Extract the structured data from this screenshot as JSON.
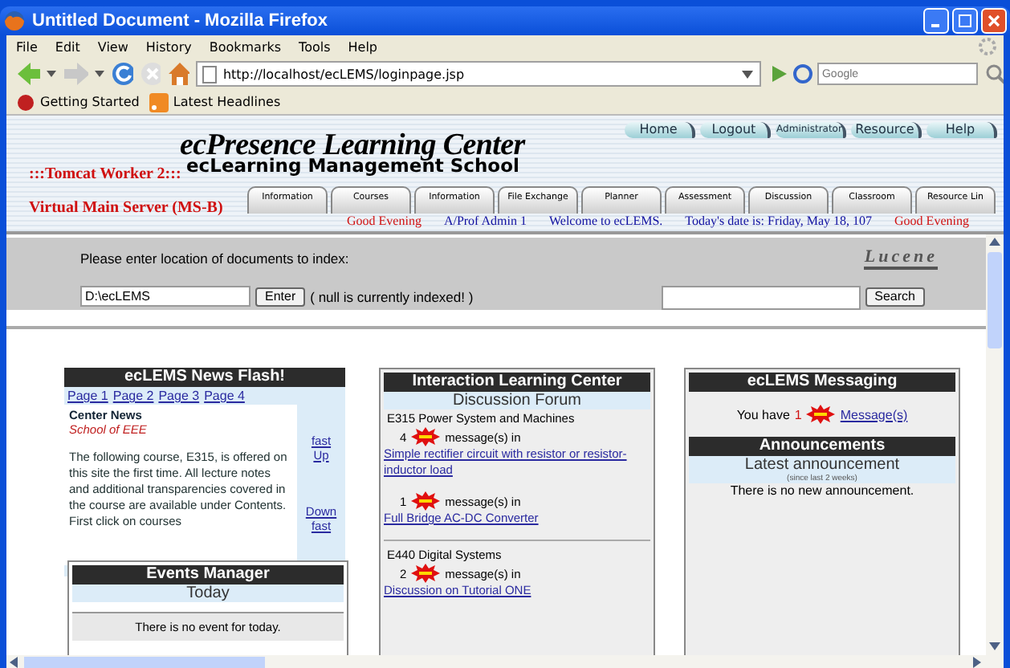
{
  "window": {
    "title": "Untitled Document - Mozilla Firefox"
  },
  "menu": [
    "File",
    "Edit",
    "View",
    "History",
    "Bookmarks",
    "Tools",
    "Help"
  ],
  "toolbar": {
    "url": "http://localhost/ecLEMS/loginpage.jsp",
    "search_placeholder": "Google"
  },
  "bookmarks": [
    "Getting Started",
    "Latest Headlines"
  ],
  "header": {
    "nav_buttons": [
      "Home",
      "Logout",
      "Administrator",
      "Resource",
      "Help"
    ],
    "title": "ecPresence Learning Center",
    "subtitle": "ecLearning Management School",
    "worker": ":::Tomcat Worker 2:::",
    "server": "Virtual Main Server (MS-B)",
    "tabs": [
      {
        "label": "Information",
        "selected": false
      },
      {
        "label": "Courses",
        "selected": false
      },
      {
        "label": "Information",
        "selected": false
      },
      {
        "label": "File Exchange",
        "selected": false
      },
      {
        "label": "Planner",
        "selected": false
      },
      {
        "label": "Assessment",
        "selected": false
      },
      {
        "label": "Discussion",
        "selected": false
      },
      {
        "label": "Classroom",
        "selected": false
      },
      {
        "label": "Resource Lin",
        "selected": false
      }
    ],
    "status_line": [
      {
        "text": "Good Evening",
        "kind": "greeting"
      },
      {
        "text": "A/Prof Admin 1",
        "kind": "info"
      },
      {
        "text": "Welcome to ecLEMS.",
        "kind": "info"
      },
      {
        "text": "Today's date is: Friday, May 18, 107",
        "kind": "info"
      },
      {
        "text": "Good Evening",
        "kind": "greeting"
      }
    ]
  },
  "index_panel": {
    "prompt": "Please enter location of documents to index:",
    "path": "D:\\ecLEMS",
    "enter_button": "Enter",
    "note": "( null is currently indexed! )",
    "logo": "Lucene",
    "search_button": "Search"
  },
  "news": {
    "title": "ecLEMS News Flash!",
    "pages": [
      "Page 1",
      "Page 2",
      "Page 3",
      "Page 4"
    ],
    "heading": "Center News",
    "source": "School of EEE",
    "body": "The following course, E315, is offered on this site the first time. All lecture notes and additional transparencies covered in the course are available under Contents. First click on courses",
    "scroll_up": "fast Up",
    "scroll_down": "Down fast"
  },
  "events": {
    "title": "Events Manager",
    "subtitle": "Today",
    "message": "There is no event for today."
  },
  "forum": {
    "title": "Interaction Learning Center",
    "subtitle": "Discussion Forum",
    "groups": [
      {
        "course": "E315 Power System and Machines",
        "posts": [
          {
            "count": "4",
            "label": "message(s) in",
            "topic": "Simple rectifier circuit with resistor or resistor-inductor load"
          },
          {
            "count": "1",
            "label": "message(s) in",
            "topic": "Full Bridge AC-DC Converter"
          }
        ]
      },
      {
        "course": "E440 Digital Systems",
        "posts": [
          {
            "count": "2",
            "label": "message(s) in",
            "topic": "Discussion on Tutorial ONE"
          }
        ]
      }
    ]
  },
  "messaging": {
    "title": "ecLEMS Messaging",
    "prefix": "You have",
    "count": "1",
    "link": "Message(s)"
  },
  "announcements": {
    "title": "Announcements",
    "subtitle": "Latest announcement",
    "period": "(since last 2 weeks)",
    "message": "There is no new announcement."
  }
}
